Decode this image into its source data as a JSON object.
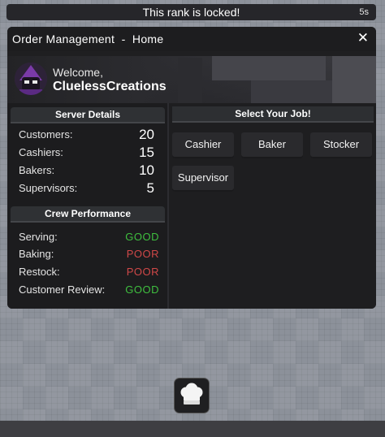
{
  "banner": {
    "text": "This rank is locked!",
    "timer": "5s"
  },
  "window": {
    "title": "Order Management  -  Home",
    "close": "✕"
  },
  "welcome": {
    "greeting": "Welcome,",
    "username": "CluelessCreations"
  },
  "server_details": {
    "header": "Server Details",
    "rows": [
      {
        "label": "Customers:",
        "value": "20"
      },
      {
        "label": "Cashiers:",
        "value": "15"
      },
      {
        "label": "Bakers:",
        "value": "10"
      },
      {
        "label": "Supervisors:",
        "value": "5"
      }
    ]
  },
  "crew_performance": {
    "header": "Crew Performance",
    "rows": [
      {
        "label": "Serving:",
        "value": "GOOD",
        "color": "#3fbf3f"
      },
      {
        "label": "Baking:",
        "value": "POOR",
        "color": "#d04848"
      },
      {
        "label": "Restock:",
        "value": "POOR",
        "color": "#d04848"
      },
      {
        "label": "Customer Review:",
        "value": "GOOD",
        "color": "#3fbf3f"
      }
    ]
  },
  "jobs": {
    "header": "Select Your Job!",
    "buttons": [
      "Cashier",
      "Baker",
      "Stocker",
      "Supervisor"
    ]
  },
  "hotbar": {
    "icon": "chef-hat-icon"
  }
}
